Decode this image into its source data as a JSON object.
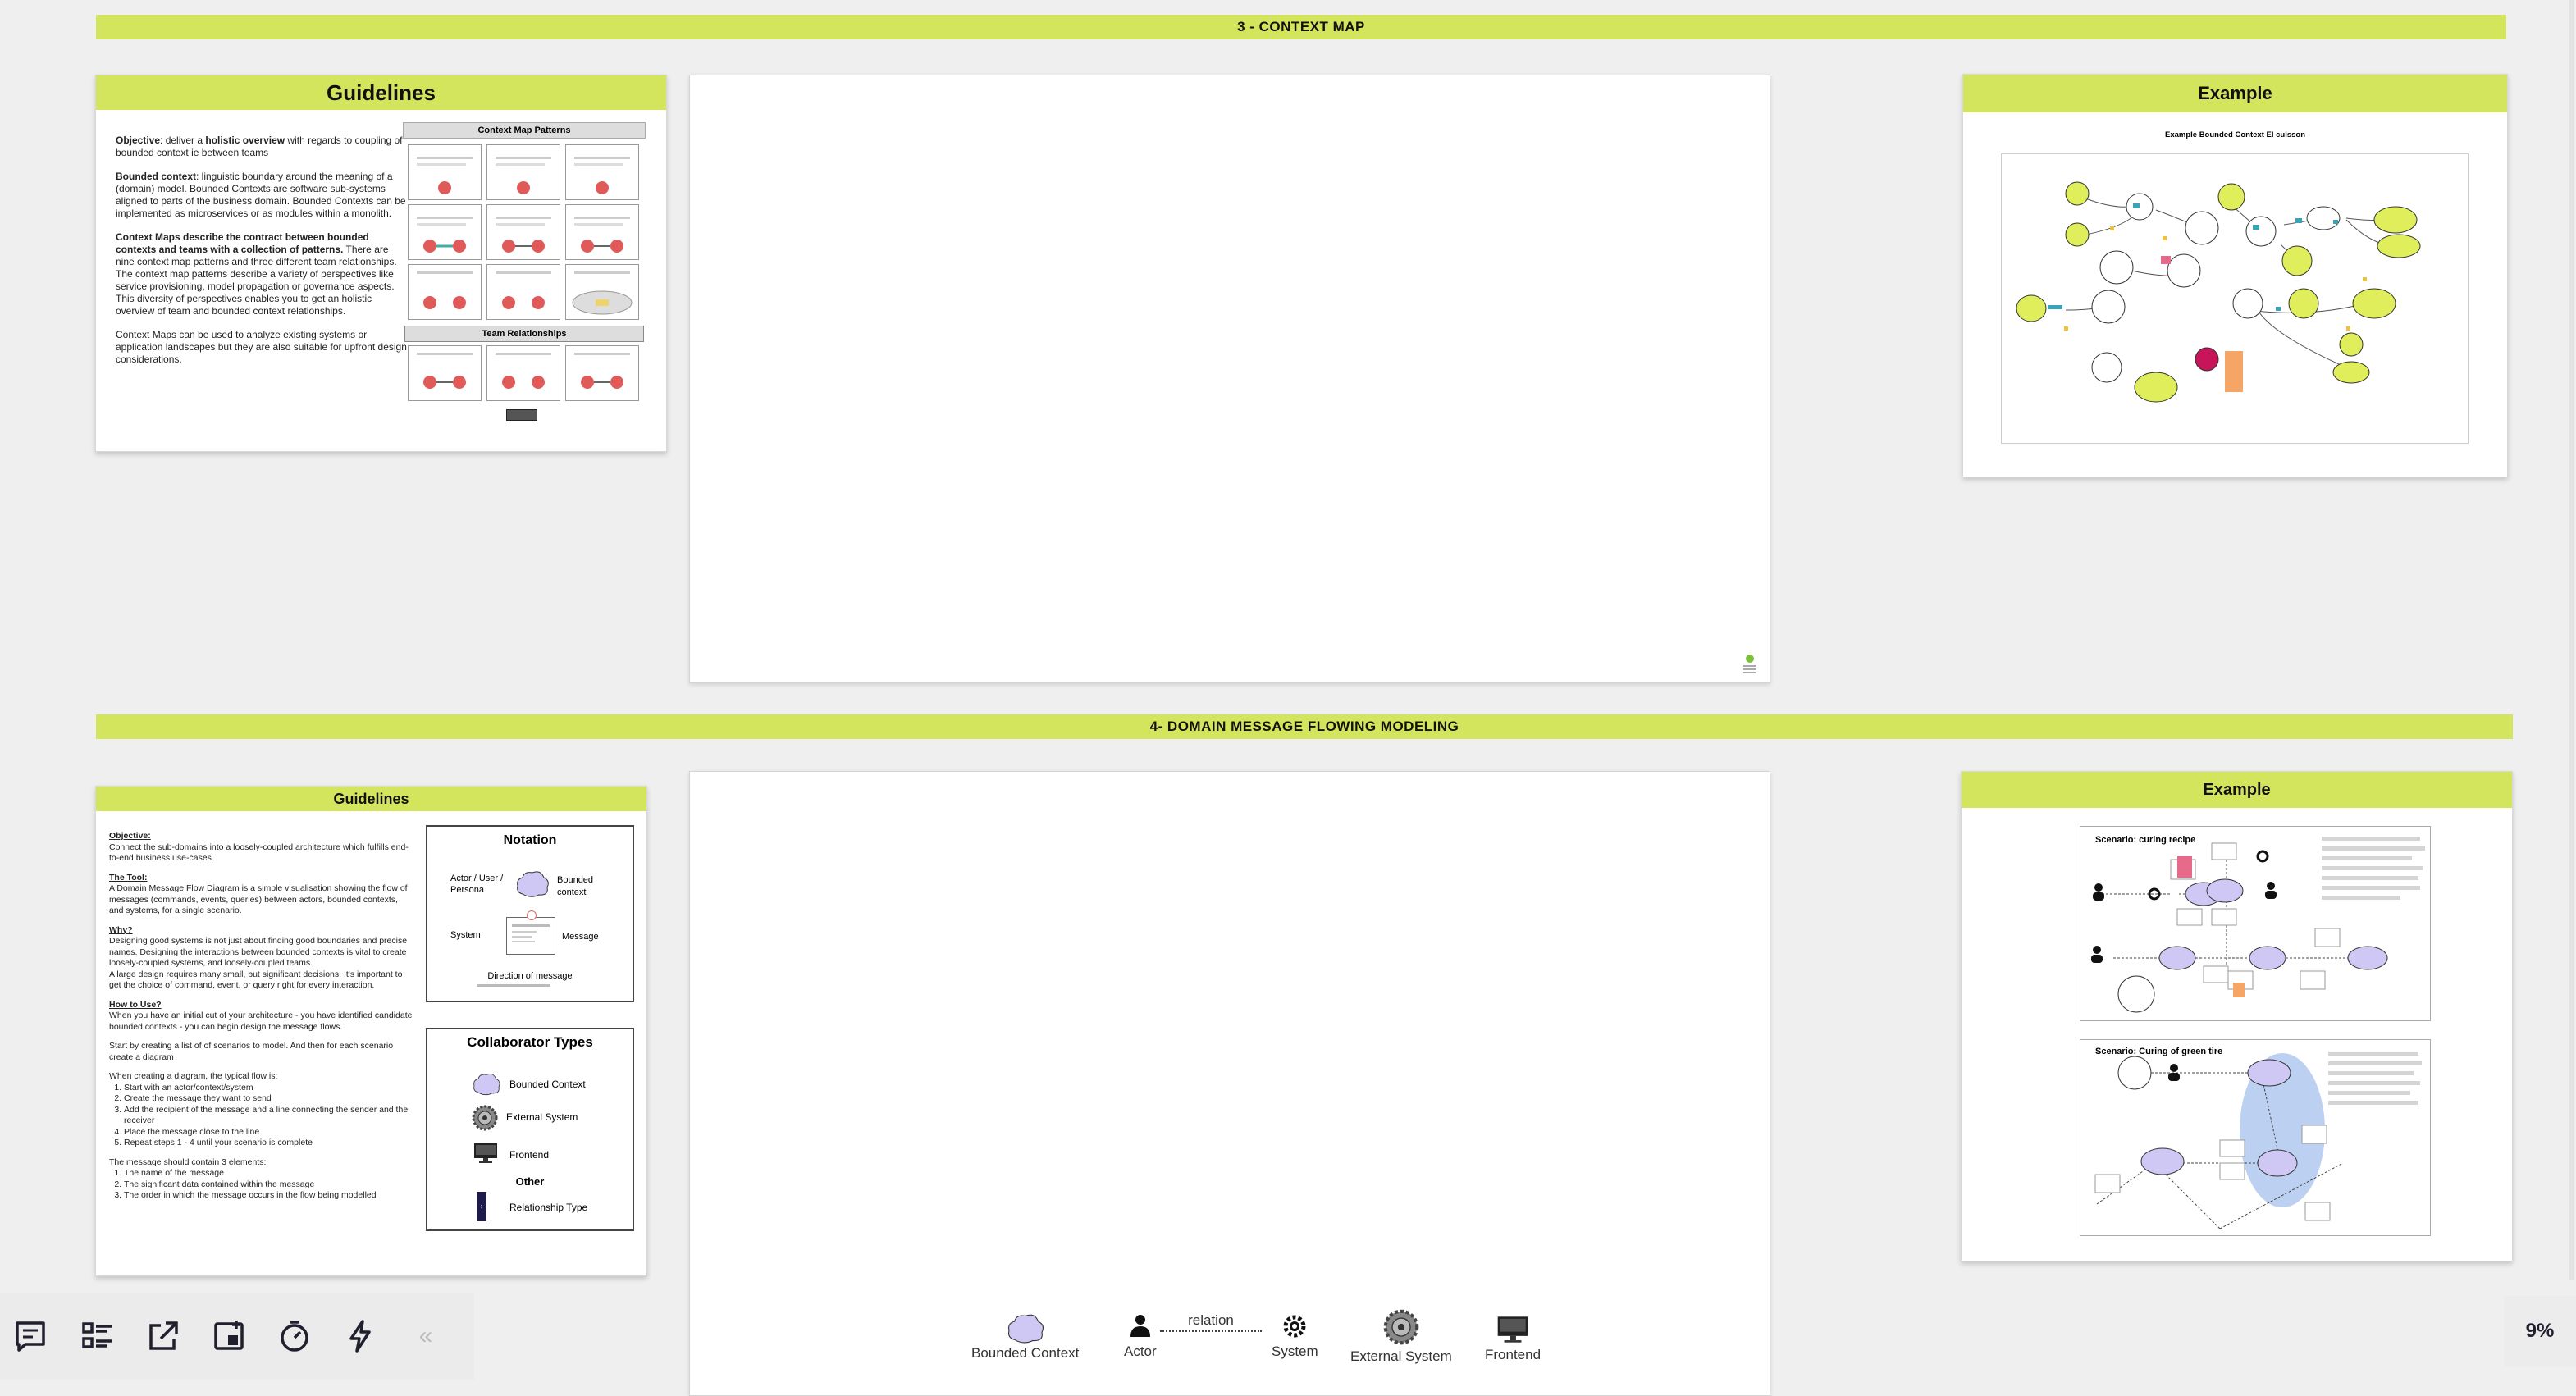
{
  "section3": {
    "banner": "3 - CONTEXT MAP"
  },
  "section4": {
    "banner": "4- DOMAIN MESSAGE FLOWING MODELING"
  },
  "guidelines1": {
    "title": "Guidelines",
    "p1_strong1": "Objective",
    "p1_a": ": deliver a ",
    "p1_strong2": "holistic overview",
    "p1_b": " with regards to coupling of bounded context ie between teams",
    "p2_strong": "Bounded context",
    "p2_text": ": linguistic boundary around the meaning of a (domain) model. Bounded Contexts are software sub-systems aligned to parts of the business domain. Bounded Contexts can be implemented as microservices or as modules within a monolith.",
    "p3_strong": "Context Maps describe the contract between bounded contexts and teams with a collection of patterns.",
    "p3_text": " There are nine context map patterns and three different team relationships. The context map patterns describe a variety of perspectives like service provisioning, model propagation or governance aspects. This diversity of perspectives enables you to get an holistic overview of team and bounded context relationships.",
    "p4": "Context Maps can be used to analyze existing systems or application landscapes but they are also suitable for upfront design considerations.",
    "patterns_title": "Context Map Patterns",
    "team_title": "Team Relationships"
  },
  "example1": {
    "title": "Example",
    "subtitle": "Example Bounded Context El cuisson"
  },
  "guidelines2": {
    "title": "Guidelines",
    "objective_h": "Objective:",
    "objective": "Connect the sub-domains into a loosely-coupled architecture which fulfills end-to-end business use-cases.",
    "tool_h": "The Tool:",
    "tool": "A Domain Message Flow Diagram is a simple visualisation showing the flow of messages (commands, events, queries) between actors, bounded contexts, and systems, for a single scenario.",
    "why_h": "Why?",
    "why1": "Designing good systems is not just about finding good boundaries and precise names. Designing the interactions between bounded contexts is vital to create loosely-coupled systems, and loosely-coupled teams.",
    "why2": "A large design requires many small, but significant decisions. It's important to get the choice of command, event, or query right for every interaction.",
    "how_h": "How to Use?",
    "how1": "When you have an initial cut of your architecture - you have identified candidate bounded contexts - you can begin design the message flows.",
    "how2": "Start by creating a list of of scenarios to model. And then for each scenario create a diagram",
    "how3": "When creating a diagram, the typical flow is:",
    "steps": [
      "Start with an actor/context/system",
      "Create the message they want to send",
      "Add the recipient of the message and a line connecting the sender and the receiver",
      "Place the message close to the line",
      "Repeat steps 1 - 4 until your scenario is complete"
    ],
    "msg_h": "The message should contain 3 elements:",
    "msg_items": [
      "The name of the message",
      "The significant data contained within the message",
      "The order in which the message occurs in the flow being modelled"
    ],
    "notation": {
      "title": "Notation",
      "actor": "Actor / User / Persona",
      "bounded": "Bounded context",
      "system": "System",
      "message": "Message",
      "direction": "Direction of message"
    },
    "collab": {
      "title": "Collaborator Types",
      "bounded": "Bounded Context",
      "external": "External System",
      "frontend": "Frontend",
      "other": "Other",
      "relationship": "Relationship Type"
    }
  },
  "example2": {
    "title": "Example",
    "scenario1": "Scenario: curing recipe",
    "scenario2": "Scenario: Curing of green tire"
  },
  "palette": {
    "bounded": "Bounded Context",
    "actor": "Actor",
    "relation": "relation",
    "system": "System",
    "external": "External System",
    "frontend": "Frontend"
  },
  "toolbar": {
    "collapse": "«"
  },
  "zoom": "9%",
  "colors": {
    "accent": "#d3e55c",
    "bounded_context": "#cfc8f5",
    "node_yellow": "#dfee5a"
  }
}
